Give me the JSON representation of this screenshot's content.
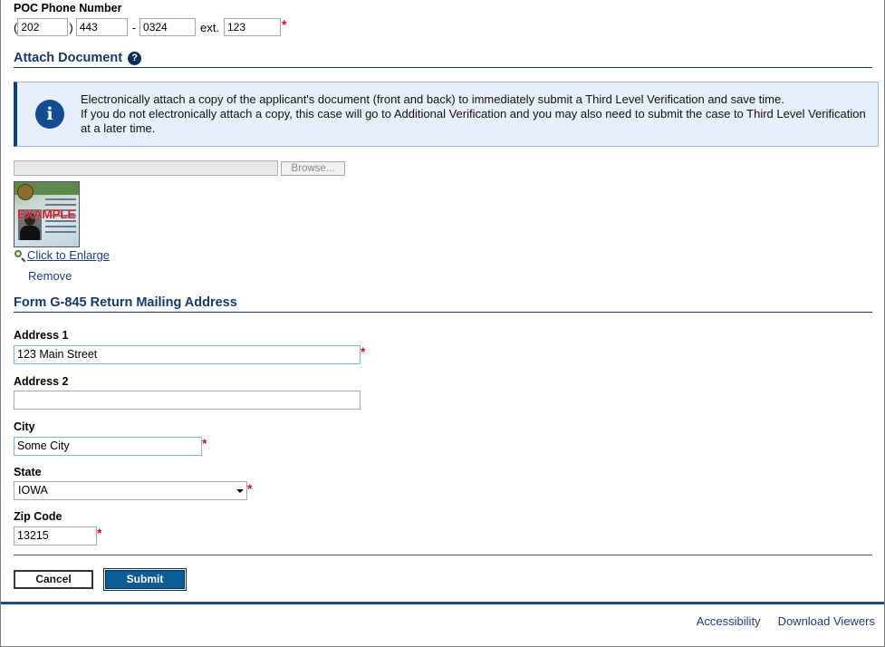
{
  "phone": {
    "label": "POC Phone Number",
    "open_paren": "(",
    "close_paren": ")",
    "dash": "-",
    "ext_label": "ext.",
    "area": "202",
    "prefix": "443",
    "line": "0324",
    "ext": "123",
    "required": "*"
  },
  "attach": {
    "title": "Attach Document",
    "help_icon": "question-icon",
    "info_icon": "info-icon",
    "info_line1": "Electronically attach a copy of the applicant's document (front and back) to immediately submit a Third Level Verification and save time.",
    "info_line2": "If you do not electronically attach a copy, this case will go to Additional Verification and you may also need to submit the case to Third Level Verification at a later time.",
    "file_path": "",
    "browse_label": "Browse...",
    "thumbnail_stamp": "EXAMPLE",
    "enlarge_label": "Click to Enlarge",
    "remove_label": "Remove"
  },
  "address": {
    "title": "Form G-845 Return Mailing Address",
    "address1_label": "Address 1",
    "address1_value": "123 Main Street",
    "address2_label": "Address 2",
    "address2_value": "",
    "city_label": "City",
    "city_value": "Some City",
    "state_label": "State",
    "state_value": "IOWA",
    "zip_label": "Zip Code",
    "zip_value": "13215",
    "required": "*"
  },
  "actions": {
    "cancel_label": "Cancel",
    "submit_label": "Submit"
  },
  "footer": {
    "accessibility": "Accessibility",
    "download_viewers": "Download Viewers"
  },
  "colors": {
    "heading": "#153a6b",
    "required": "#c0122b",
    "submit_bg": "#0d5c95",
    "info_bg": "#e7effb",
    "footer_bar": "#1d4a7e"
  }
}
